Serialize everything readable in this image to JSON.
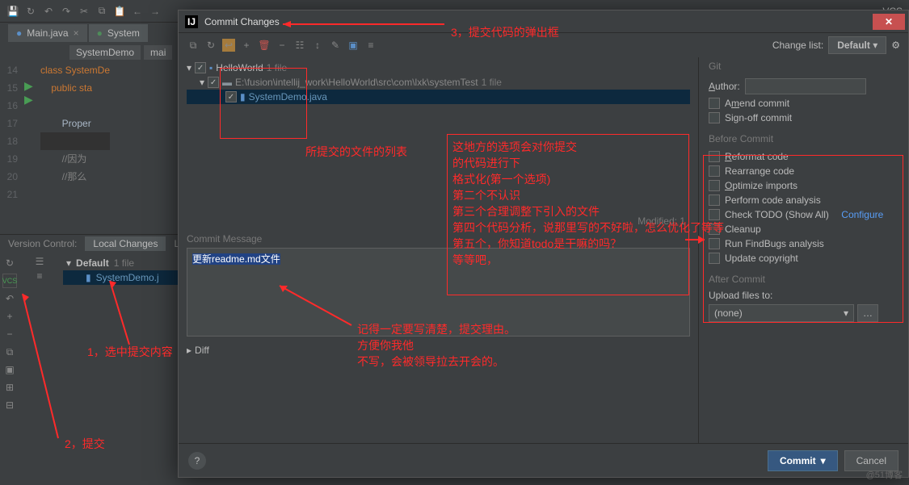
{
  "menu": {
    "vcs_label": "VCS"
  },
  "tabs": [
    {
      "label": "Main.java"
    },
    {
      "label": "System"
    }
  ],
  "breadcrumb": {
    "class": "SystemDemo",
    "method": "mai"
  },
  "code": {
    "lines": [
      "14",
      "15",
      "16",
      "17",
      "18",
      "19",
      "20",
      "21"
    ],
    "l14": "class SystemDe",
    "l15": "    public sta",
    "l17": "        Proper",
    "l19": "        //因为",
    "l20": "        //那么"
  },
  "vc": {
    "panel_label": "Version Control:",
    "local_tab": "Local Changes",
    "log_tab": "L",
    "default_label": "Default",
    "file_count": "1 file",
    "file": "SystemDemo.j",
    "commit_badge": "VCS"
  },
  "dialog": {
    "title": "Commit Changes",
    "change_list_label": "Change list:",
    "change_list_value": "Default",
    "tree": {
      "root": "HelloWorld",
      "root_count": "1 file",
      "path": "E:\\fusion\\intellij_work\\HelloWorld\\src\\com\\lxk\\systemTest",
      "path_count": "1 file",
      "file": "SystemDemo.java"
    },
    "modified": "Modified: 1",
    "commit_msg_label": "Commit Message",
    "commit_msg_value": "更新readme.md文件",
    "diff_label": "Diff",
    "git": {
      "title": "Git",
      "author_label": "Author:",
      "amend": "Amend commit",
      "signoff": "Sign-off commit"
    },
    "before": {
      "title": "Before Commit",
      "reformat": "Reformat code",
      "rearrange": "Rearrange code",
      "optimize": "Optimize imports",
      "analysis": "Perform code analysis",
      "todo": "Check TODO (Show All)",
      "configure": "Configure",
      "cleanup": "Cleanup",
      "findbugs": "Run FindBugs analysis",
      "copyright": "Update copyright"
    },
    "after": {
      "title": "After Commit",
      "upload_label": "Upload files to:",
      "upload_value": "(none)"
    },
    "footer": {
      "commit": "Commit",
      "cancel": "Cancel"
    }
  },
  "annotations": {
    "a1": "1，选中提交内容",
    "a2": "2，提交",
    "a3": "3，提交代码的弹出框",
    "a4": "所提交的文件的列表",
    "a5": "这地方的选项会对你提交\n的代码进行下\n格式化(第一个选项)\n第二个不认识\n第三个合理调整下引入的文件\n第四个代码分析，说那里写的不好啦，怎么优化了等等\n第五个，你知道todo是干嘛的吗？\n等等吧，",
    "a6": "记得一定要写清楚，提交理由。\n方便你我他\n不写，会被领导拉去开会的。"
  },
  "watermark": "@51博客"
}
